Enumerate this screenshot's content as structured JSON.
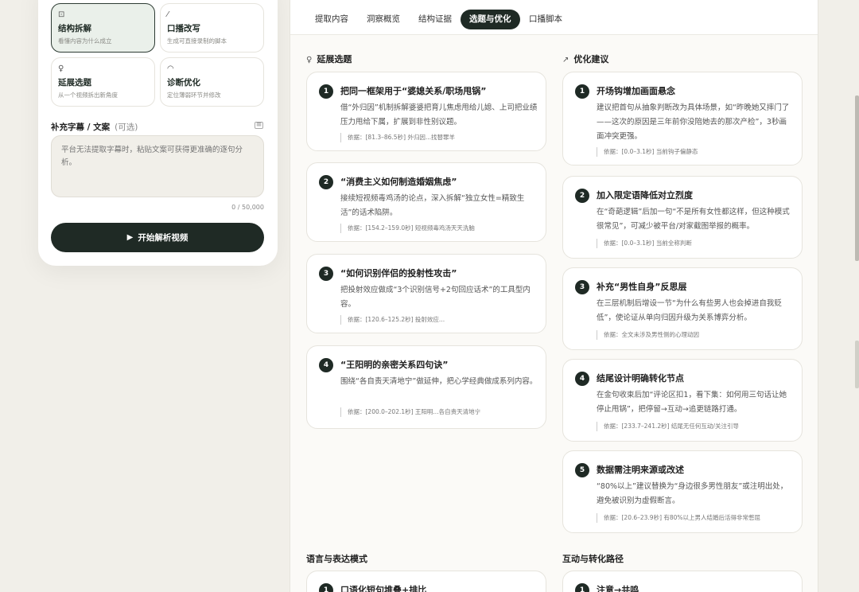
{
  "modes": [
    {
      "icon": "⊡",
      "title": "结构拆解",
      "desc": "看懂内容为什么成立",
      "active": true
    },
    {
      "icon": "⁄",
      "title": "口播改写",
      "desc": "生成可直接录制的脚本",
      "active": false
    },
    {
      "icon": "♀",
      "title": "延展选题",
      "desc": "从一个视频拆出新角度",
      "active": false
    },
    {
      "icon": "◠",
      "title": "诊断优化",
      "desc": "定位薄弱环节并修改",
      "active": false
    }
  ],
  "subtitle": {
    "label": "补充字幕 / 文案",
    "optional": "(可选)",
    "placeholder": "平台无法提取字幕时，粘贴文案可获得更准确的逐句分析。",
    "counter": "0 / 50,000"
  },
  "start_button": "开始解析视频",
  "tabs": [
    {
      "label": "提取内容"
    },
    {
      "label": "洞察概览"
    },
    {
      "label": "结构证据"
    },
    {
      "label": "选题与优化",
      "active": true
    },
    {
      "label": "口播脚本"
    }
  ],
  "sections": {
    "extend": {
      "title": "延展选题",
      "items": [
        {
          "num": "1",
          "title": "把同一框架用于“婆媳关系/职场甩锅”",
          "body": "借“外归因”机制拆解婆婆把育儿焦虑甩给儿媳、上司把业绩压力甩给下属，扩展到非性别议题。",
          "basis": "依据：[81.3–86.5秒] 外归因...找替罪羊"
        },
        {
          "num": "2",
          "title": "“消费主义如何制造婚姻焦虑”",
          "body": "接续短视频毒鸡汤的论点，深入拆解“独立女性=精致生活”的话术陷阱。",
          "basis": "依据：[154.2–159.0秒] 短视频毒鸡汤天天洗脑"
        },
        {
          "num": "3",
          "title": "“如何识别伴侣的投射性攻击”",
          "body": "把投射效应做成“3个识别信号+2句回应话术”的工具型内容。",
          "basis": "依据：[120.6–125.2秒] 投射效应..."
        },
        {
          "num": "4",
          "title": "“王阳明的亲密关系四句诀”",
          "body": "围绕“各自责天清地宁”做延伸，把心学经典做成系列内容。",
          "basis": "依据：[200.0–202.1秒] 王阳明...各自责天清地宁"
        }
      ]
    },
    "optimize": {
      "title": "优化建议",
      "items": [
        {
          "num": "1",
          "title": "开场钩增加画面悬念",
          "body": "建议把首句从抽象判断改为具体场景，如“昨晚她又摔门了——这次的原因是三年前你没陪她去的那次产检”，3秒画面冲突更强。",
          "basis": "依据：[0.0–3.1秒] 当前钩子偏静态"
        },
        {
          "num": "2",
          "title": "加入限定语降低对立烈度",
          "body": "在“奇葩逻辑”后加一句“不是所有女性都这样，但这种模式很常见”，可减少被平台/对家截图举报的概率。",
          "basis": "依据：[0.0–3.1秒] 当前全称判断"
        },
        {
          "num": "3",
          "title": "补充“男性自身”反思层",
          "body": "在三层机制后增设一节“为什么有些男人也会掉进自我贬低”，使论证从单向归因升级为关系博弈分析。",
          "basis": "依据：全文未涉及男性侧的心理动因"
        },
        {
          "num": "4",
          "title": "结尾设计明确转化节点",
          "body": "在金句收束后加“评论区扣1，看下集：如何用三句话让她停止甩锅”，把停留→互动→追更链路打通。",
          "basis": "依据：[233.7–241.2秒] 结尾无任何互动/关注引导"
        },
        {
          "num": "5",
          "title": "数据需注明来源或改述",
          "body": "“80%以上”建议替换为“身边很多男性朋友”或注明出处，避免被识别为虚假断言。",
          "basis": "依据：[20.6–23.9秒] 有80%以上男人结婚后活得非常憋屈"
        }
      ]
    },
    "language": {
      "title": "语言与表达模式",
      "items": [
        {
          "num": "1",
          "title": "口语化短句堆叠+排比"
        }
      ]
    },
    "interaction": {
      "title": "互动与转化路径",
      "items": [
        {
          "num": "1",
          "title": "注意→共鸣"
        }
      ]
    }
  }
}
